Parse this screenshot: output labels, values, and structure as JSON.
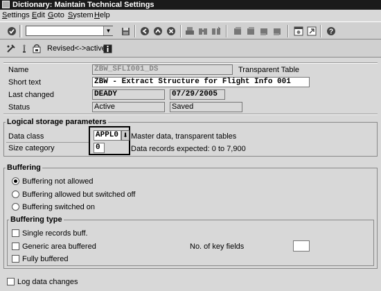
{
  "window": {
    "title": "Dictionary: Maintain Technical Settings"
  },
  "menu": [
    {
      "label": "Settings",
      "ul": "S",
      "rest": "ettings"
    },
    {
      "label": "Edit",
      "ul": "E",
      "rest": "dit"
    },
    {
      "label": "Goto",
      "ul": "G",
      "rest": "oto"
    },
    {
      "label": "System",
      "ul": "S",
      "rest": "ystem"
    },
    {
      "label": "Help",
      "ul": "H",
      "rest": "elp"
    }
  ],
  "toolbar": {
    "command_value": "",
    "icons": [
      "enter-icon",
      "save-icon",
      "back-icon",
      "exit-icon",
      "cancel-icon",
      "print-icon",
      "find-icon",
      "find-next-icon",
      "first-page-icon",
      "previous-page-icon",
      "next-page-icon",
      "last-page-icon",
      "new-session-icon",
      "shortcut-icon",
      "help-icon"
    ]
  },
  "app_toolbar": {
    "revised_active": "Revised<->active"
  },
  "header": {
    "name_label": "Name",
    "name_value": "ZBW_SFLI001_DS",
    "table_type": "Transparent Table",
    "short_text_label": "Short text",
    "short_text_value": "ZBW - Extract Structure for Flight Info 001",
    "last_changed_label": "Last changed",
    "last_changed_user": "DEADY",
    "last_changed_date": "07/29/2005",
    "status_label": "Status",
    "status_value": "Active",
    "status_saved": "Saved"
  },
  "logical_storage": {
    "title": "Logical storage parameters",
    "data_class_label": "Data class",
    "data_class_value": "APPL0",
    "data_class_desc": "Master data, transparent tables",
    "size_category_label": "Size category",
    "size_category_value": "0",
    "size_category_desc": "Data records expected: 0 to 7,900"
  },
  "buffering": {
    "title": "Buffering",
    "options": [
      "Buffering not allowed",
      "Buffering allowed but switched off",
      "Buffering switched on"
    ],
    "selected": 0
  },
  "buffering_type": {
    "title": "Buffering type",
    "single": "Single records buff.",
    "generic": "Generic area buffered",
    "full": "Fully buffered",
    "key_fields_label": "No. of key fields",
    "key_fields_value": ""
  },
  "log_data_changes": "Log data changes"
}
